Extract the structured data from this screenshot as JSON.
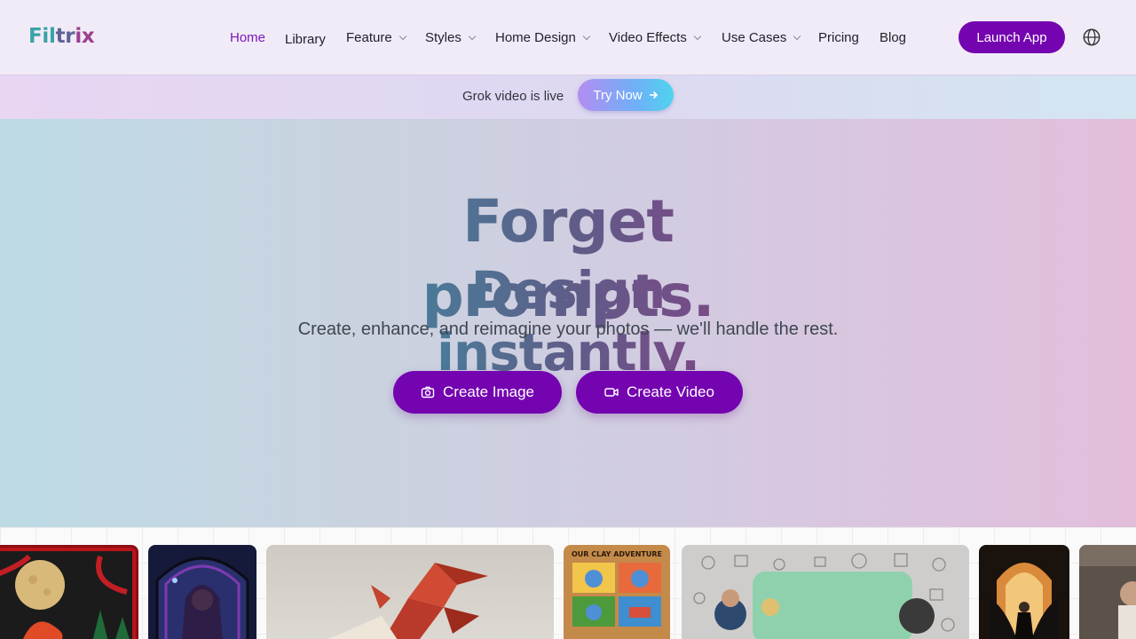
{
  "brand": {
    "part1": "Fil",
    "part2": "tr",
    "part3": "ix"
  },
  "nav": {
    "items": [
      {
        "label": "Home",
        "active": true,
        "dropdown": false
      },
      {
        "label": "Library",
        "active": false,
        "dropdown": false
      },
      {
        "label": "Feature",
        "active": false,
        "dropdown": true
      },
      {
        "label": "Styles",
        "active": false,
        "dropdown": true
      },
      {
        "label": "Home Design",
        "active": false,
        "dropdown": true
      },
      {
        "label": "Video Effects",
        "active": false,
        "dropdown": true
      },
      {
        "label": "Use Cases",
        "active": false,
        "dropdown": true
      },
      {
        "label": "Pricing",
        "active": false,
        "dropdown": false
      },
      {
        "label": "Blog",
        "active": false,
        "dropdown": false
      }
    ],
    "launch_label": "Launch App",
    "language_icon": "globe-icon"
  },
  "announcement": {
    "text": "Grok video is live",
    "button_label": "Try Now"
  },
  "hero": {
    "headline_1": "Forget prompts.",
    "headline_2": "Design instantly.",
    "subtitle": "Create, enhance, and reimagine your photos — we'll handle the rest.",
    "create_image_label": "Create Image",
    "create_video_label": "Create Video"
  },
  "colors": {
    "accent": "#7403b0",
    "active_nav": "#7a16b8",
    "headline_gradient": [
      "#3d8fa3",
      "#5e5d88",
      "#8c3d86"
    ]
  },
  "gallery": {
    "cards": [
      {
        "name": "moon-fox-papercut",
        "caption": ""
      },
      {
        "name": "stained-glass-witch",
        "caption": ""
      },
      {
        "name": "origami-dragon",
        "caption": ""
      },
      {
        "name": "clay-adventure-comic",
        "caption": "OUR CLAY ADVENTURE"
      },
      {
        "name": "doodle-wall-table",
        "caption": ""
      },
      {
        "name": "dark-angel",
        "caption": ""
      },
      {
        "name": "kitchen-photo",
        "caption": ""
      }
    ]
  }
}
